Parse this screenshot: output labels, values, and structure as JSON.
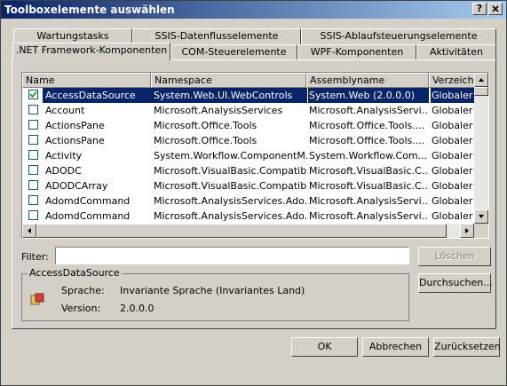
{
  "window": {
    "title": "Toolboxelemente auswählen",
    "help_label": "?",
    "close_label": "X"
  },
  "tabs_back": [
    {
      "label": "Wartungstasks"
    },
    {
      "label": "SSIS-Datenflusselemente"
    },
    {
      "label": "SSIS-Ablaufsteuerungselemente"
    }
  ],
  "tabs_front": [
    {
      "label": ".NET Framework-Komponenten"
    },
    {
      "label": "COM-Steuerelemente"
    },
    {
      "label": "WPF-Komponenten"
    },
    {
      "label": "Aktivitäten"
    }
  ],
  "columns": [
    "Name",
    "Namespace",
    "Assemblyname",
    "Verzeichnis"
  ],
  "rows": [
    {
      "checked": true,
      "name": "AccessDataSource",
      "namespace": "System.Web.UI.WebControls",
      "assembly": "System.Web (2.0.0.0)",
      "dir": "Globaler A"
    },
    {
      "checked": false,
      "name": "Account",
      "namespace": "Microsoft.AnalysisServices",
      "assembly": "Microsoft.AnalysisServi...",
      "dir": "Globaler A"
    },
    {
      "checked": false,
      "name": "ActionsPane",
      "namespace": "Microsoft.Office.Tools",
      "assembly": "Microsoft.Office.Tools....",
      "dir": "Globaler A"
    },
    {
      "checked": false,
      "name": "ActionsPane",
      "namespace": "Microsoft.Office.Tools",
      "assembly": "Microsoft.Office.Tools....",
      "dir": "Globaler A"
    },
    {
      "checked": false,
      "name": "Activity",
      "namespace": "System.Workflow.ComponentM...",
      "assembly": "System.Workflow.Com...",
      "dir": "Globaler A"
    },
    {
      "checked": false,
      "name": "ADODC",
      "namespace": "Microsoft.VisualBasic.Compatibi...",
      "assembly": "Microsoft.VisualBasic.C...",
      "dir": "Globaler A"
    },
    {
      "checked": false,
      "name": "ADODCArray",
      "namespace": "Microsoft.VisualBasic.Compatibi...",
      "assembly": "Microsoft.VisualBasic.C...",
      "dir": "Globaler A"
    },
    {
      "checked": false,
      "name": "AdomdCommand",
      "namespace": "Microsoft.AnalysisServices.Ado...",
      "assembly": "Microsoft.AnalysisServi...",
      "dir": "Globaler A"
    },
    {
      "checked": false,
      "name": "AdomdCommand",
      "namespace": "Microsoft.AnalysisServices.Ado...",
      "assembly": "Microsoft.AnalysisServi...",
      "dir": "Globaler A"
    }
  ],
  "filter": {
    "label": "Filter:",
    "value": ""
  },
  "buttons": {
    "clear": "Löschen",
    "browse": "Durchsuchen...",
    "ok": "OK",
    "cancel": "Abbrechen",
    "reset": "Zurücksetzen"
  },
  "details": {
    "legend": "AccessDataSource",
    "language_label": "Sprache:",
    "language_value": "Invariante Sprache (Invariantes Land)",
    "version_label": "Version:",
    "version_value": "2.0.0.0"
  },
  "colors": {
    "titlebar_start": "#0a246a",
    "titlebar_end": "#a6caf0",
    "selection": "#0a246a",
    "face": "#d4d0c8"
  }
}
